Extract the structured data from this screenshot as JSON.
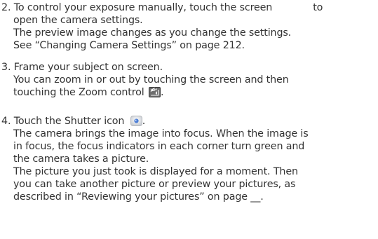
{
  "steps": [
    {
      "number": "2.",
      "line1_before": "To control your exposure manually, touch the screen",
      "line1_after": "to",
      "line2": "open the camera settings.",
      "line3": "The preview image changes as you change the settings.",
      "line4": "See “Changing Camera Settings” on page 212."
    },
    {
      "number": "3.",
      "line1": "Frame your subject on screen.",
      "line2": "You can zoom in or out by touching the screen and then",
      "line3_before": "touching the Zoom control",
      "line3_after": "."
    },
    {
      "number": "4.",
      "line1_before": "Touch the Shutter icon",
      "line1_after": ".",
      "line2": "The camera brings the image into focus. When the image is",
      "line3": "in focus, the focus indicators in each corner turn green and",
      "line4": "the camera takes a picture.",
      "line5": "The picture you just took is displayed for a moment. Then",
      "line6": "you can take another picture or preview your pictures, as",
      "line7": "described in “Reviewing your pictures” on page __."
    }
  ],
  "icons": {
    "zoom": "zoom-control-icon",
    "shutter": "shutter-icon"
  },
  "colors": {
    "text": "#333333",
    "zoom_icon_fill": "#6e6e6e",
    "shutter_icon_accent": "#4d7fd6"
  }
}
